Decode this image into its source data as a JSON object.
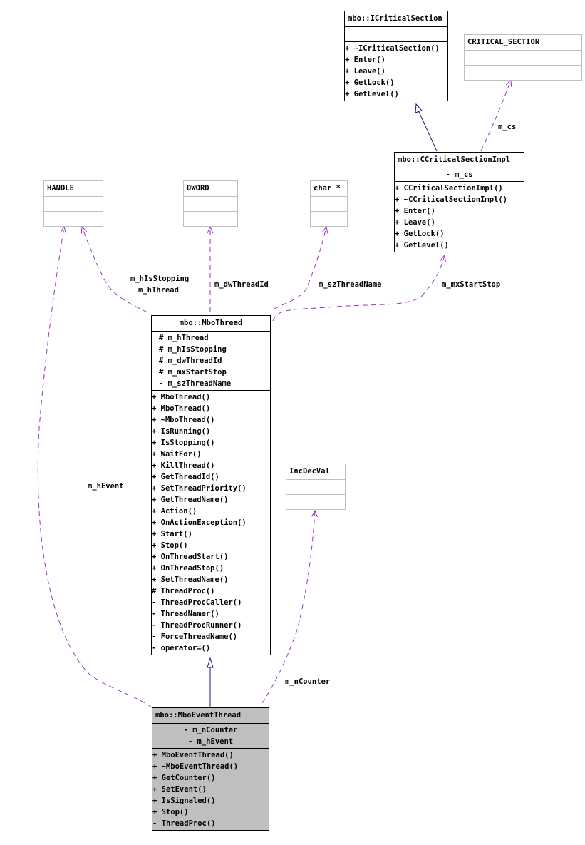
{
  "diagram": {
    "type": "collaboration-diagram",
    "colors": {
      "usage_edge": "#9a32cd",
      "inheritance_edge": "#191970",
      "node_border": "#000000",
      "external_node_border": "#bfbfbf",
      "focus_node_fill": "#bfbfbf"
    },
    "classes": {
      "icriticalsection": {
        "name": "mbo::ICriticalSection",
        "attributes": [],
        "methods": [
          "+ ~ICriticalSection()",
          "+ Enter()",
          "+ Leave()",
          "+ GetLock()",
          "+ GetLevel()"
        ]
      },
      "critical_section": {
        "name": "CRITICAL_SECTION",
        "attributes": [],
        "methods": []
      },
      "ccriticalsectionimpl": {
        "name": "mbo::CCriticalSectionImpl",
        "attributes": [
          "- m_cs"
        ],
        "methods": [
          "+ CCriticalSectionImpl()",
          "+ ~CCriticalSectionImpl()",
          "+ Enter()",
          "+ Leave()",
          "+ GetLock()",
          "+ GetLevel()"
        ]
      },
      "handle": {
        "name": "HANDLE",
        "attributes": [],
        "methods": []
      },
      "dword": {
        "name": "DWORD",
        "attributes": [],
        "methods": []
      },
      "charptr": {
        "name": "char *",
        "attributes": [],
        "methods": []
      },
      "incdecval": {
        "name": "IncDecVal",
        "attributes": [],
        "methods": []
      },
      "mbothread": {
        "name": "mbo::MboThread",
        "attributes": [
          "# m_hThread",
          "# m_hIsStopping",
          "# m_dwThreadId",
          "# m_mxStartStop",
          "- m_szThreadName"
        ],
        "methods": [
          "+ MboThread()",
          "+ MboThread()",
          "+ ~MboThread()",
          "+ IsRunning()",
          "+ IsStopping()",
          "+ WaitFor()",
          "+ KillThread()",
          "+ GetThreadId()",
          "+ SetThreadPriority()",
          "+ GetThreadName()",
          "+ Action()",
          "+ OnActionException()",
          "+ Start()",
          "+ Stop()",
          "+ OnThreadStart()",
          "+ OnThreadStop()",
          "+ SetThreadName()",
          "# ThreadProc()",
          "- ThreadProcCaller()",
          "- ThreadNamer()",
          "- ThreadProcRunner()",
          "- ForceThreadName()",
          "- operator=()"
        ]
      },
      "mboeventthread": {
        "name": "mbo::MboEventThread",
        "attributes": [
          "- m_nCounter",
          "- m_hEvent"
        ],
        "methods": [
          "+ MboEventThread()",
          "+ ~MboEventThread()",
          "+ GetCounter()",
          "+ SetEvent()",
          "+ IsSignaled()",
          "+ Stop()",
          "- ThreadProc()"
        ]
      }
    },
    "edge_labels": {
      "m_cs": "m_cs",
      "m_hIsStopping": "m_hIsStopping",
      "m_hThread": "m_hThread",
      "m_dwThreadId": "m_dwThreadId",
      "m_szThreadName": "m_szThreadName",
      "m_mxStartStop": "m_mxStartStop",
      "m_hEvent": "m_hEvent",
      "m_nCounter": "m_nCounter"
    },
    "edges": [
      {
        "from": "ccriticalsectionimpl",
        "to": "icriticalsection",
        "kind": "inheritance"
      },
      {
        "from": "ccriticalsectionimpl",
        "to": "critical_section",
        "kind": "usage",
        "label": "m_cs"
      },
      {
        "from": "mbothread",
        "to": "handle",
        "kind": "usage",
        "label": "m_hIsStopping / m_hThread"
      },
      {
        "from": "mbothread",
        "to": "dword",
        "kind": "usage",
        "label": "m_dwThreadId"
      },
      {
        "from": "mbothread",
        "to": "charptr",
        "kind": "usage",
        "label": "m_szThreadName"
      },
      {
        "from": "mbothread",
        "to": "ccriticalsectionimpl",
        "kind": "usage",
        "label": "m_mxStartStop"
      },
      {
        "from": "mboeventthread",
        "to": "mbothread",
        "kind": "inheritance"
      },
      {
        "from": "mboeventthread",
        "to": "handle",
        "kind": "usage",
        "label": "m_hEvent"
      },
      {
        "from": "mboeventthread",
        "to": "incdecval",
        "kind": "usage",
        "label": "m_nCounter"
      }
    ]
  }
}
